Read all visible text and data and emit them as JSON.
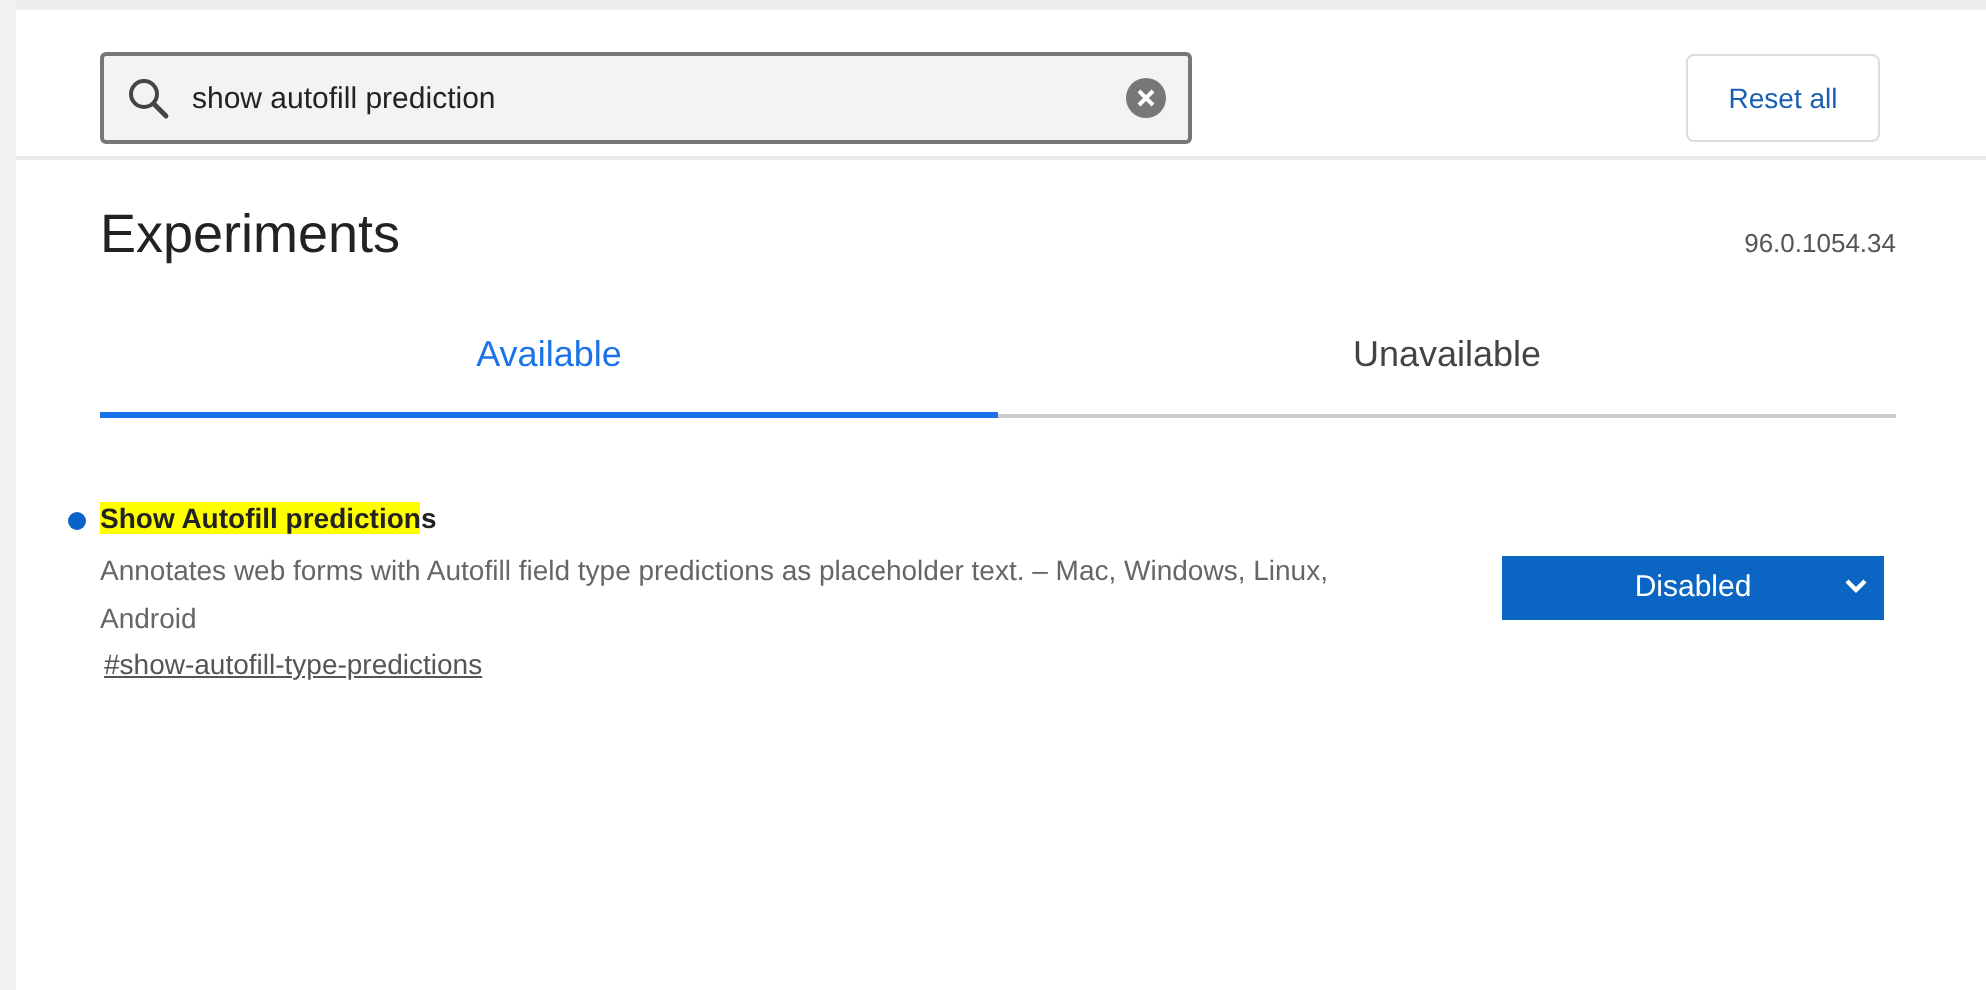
{
  "search": {
    "value": "show autofill prediction"
  },
  "reset_button": "Reset all",
  "title": "Experiments",
  "version": "96.0.1054.34",
  "tabs": [
    {
      "label": "Available",
      "selected": true
    },
    {
      "label": "Unavailable",
      "selected": false
    }
  ],
  "experiments": [
    {
      "title_match": "Show Autofill prediction",
      "title_rest": "s",
      "modified": true,
      "description": "Annotates web forms with Autofill field type predictions as placeholder text. – Mac, Windows, Linux, Android",
      "link": "#show-autofill-type-predictions",
      "selection": "Disabled"
    }
  ]
}
